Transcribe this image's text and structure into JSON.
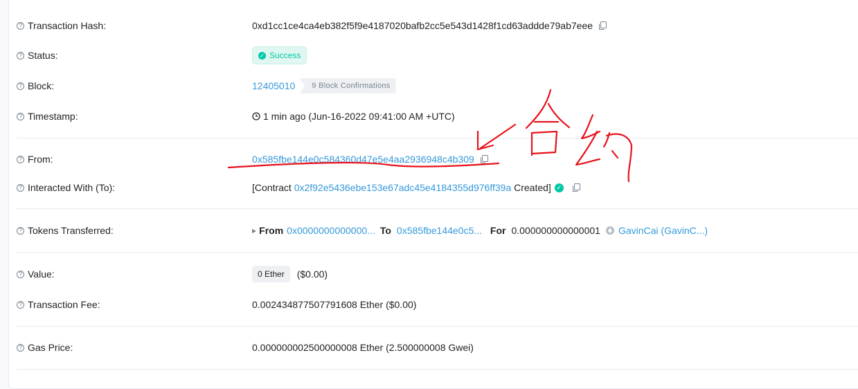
{
  "rows": {
    "tx_hash": {
      "label": "Transaction Hash:",
      "value": "0xd1cc1ce4ca4eb382f5f9e4187020bafb2cc5e543d1428f1cd63addde79ab7eee"
    },
    "status": {
      "label": "Status:",
      "value": "Success"
    },
    "block": {
      "label": "Block:",
      "number": "12405010",
      "confirmations": "9 Block Confirmations"
    },
    "timestamp": {
      "label": "Timestamp:",
      "value": "1 min ago (Jun-16-2022 09:41:00 AM +UTC)"
    },
    "from": {
      "label": "From:",
      "value": "0x585fbe144e0c584360d47e5e4aa2936948c4b309"
    },
    "interacted": {
      "label": "Interacted With (To):",
      "prefix": "[Contract ",
      "address": "0x2f92e5436ebe153e67adc45e4184355d976ff39a",
      "suffix": " Created]"
    },
    "tokens": {
      "label": "Tokens Transferred:",
      "from_label": "From",
      "from_addr": "0x0000000000000...",
      "to_label": "To",
      "to_addr": "0x585fbe144e0c5...",
      "for_label": "For",
      "amount": "0.000000000000001",
      "token": "GavinCai (GavinC...)"
    },
    "value": {
      "label": "Value:",
      "badge": "0 Ether",
      "usd": "($0.00)"
    },
    "fee": {
      "label": "Transaction Fee:",
      "value": "0.002434877507791608 Ether ($0.00)"
    },
    "gas": {
      "label": "Gas Price:",
      "value": "0.000000002500000008 Ether (2.500000008 Gwei)"
    }
  },
  "colors": {
    "link": "#3498db",
    "success": "#00c9a7",
    "annotation": "#e8101a"
  },
  "icons": [
    "question-icon",
    "copy-icon",
    "check-circle-icon",
    "clock-icon",
    "caret-right-icon",
    "ether-token-icon",
    "verified-icon"
  ]
}
